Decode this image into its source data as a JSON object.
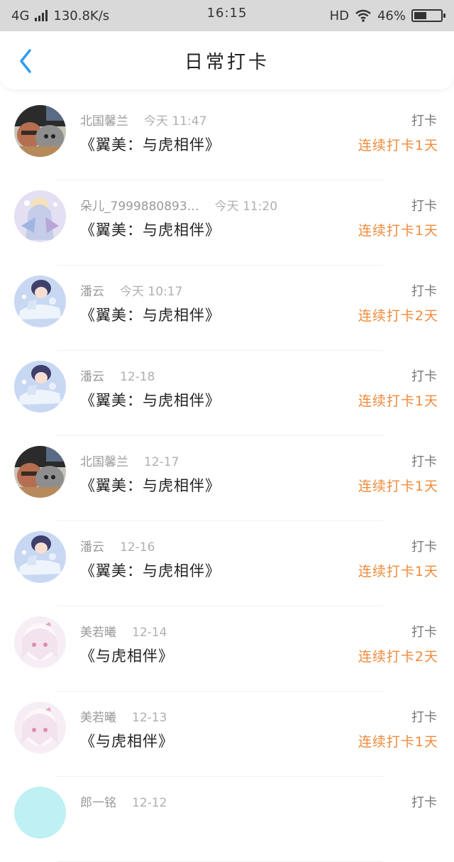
{
  "status_bar": {
    "network": "4G",
    "speed": "130.8K/s",
    "time": "16:15",
    "hd": "HD",
    "battery": "46%",
    "battery_level": 0.46
  },
  "header": {
    "title": "日常打卡",
    "back_icon": "chevron-left-icon"
  },
  "colors": {
    "accent_blue": "#2f9bf0",
    "streak_orange": "#f08a3b"
  },
  "items": [
    {
      "user": "北国馨兰",
      "time": "今天 11:47",
      "work": "《翼美：与虎相伴》",
      "tag": "打卡",
      "streak": "连续打卡1天",
      "avatar": "avatar-photo"
    },
    {
      "user": "朵儿_7999880893…",
      "time": "今天 11:20",
      "work": "《翼美：与虎相伴》",
      "tag": "打卡",
      "streak": "连续打卡1天",
      "avatar": "avatar-anime-lavender"
    },
    {
      "user": "潘云",
      "time": "今天 10:17",
      "work": "《翼美：与虎相伴》",
      "tag": "打卡",
      "streak": "连续打卡2天",
      "avatar": "avatar-anime-blue"
    },
    {
      "user": "潘云",
      "time": "12-18",
      "work": "《翼美：与虎相伴》",
      "tag": "打卡",
      "streak": "连续打卡1天",
      "avatar": "avatar-anime-blue"
    },
    {
      "user": "北国馨兰",
      "time": "12-17",
      "work": "《翼美：与虎相伴》",
      "tag": "打卡",
      "streak": "连续打卡1天",
      "avatar": "avatar-photo"
    },
    {
      "user": "潘云",
      "time": "12-16",
      "work": "《翼美：与虎相伴》",
      "tag": "打卡",
      "streak": "连续打卡1天",
      "avatar": "avatar-anime-blue"
    },
    {
      "user": "美若曦",
      "time": "12-14",
      "work": "《与虎相伴》",
      "tag": "打卡",
      "streak": "连续打卡2天",
      "avatar": "avatar-anime-pink"
    },
    {
      "user": "美若曦",
      "time": "12-13",
      "work": "《与虎相伴》",
      "tag": "打卡",
      "streak": "连续打卡1天",
      "avatar": "avatar-anime-pink"
    },
    {
      "user": "郎一铭",
      "time": "12-12",
      "work": "",
      "tag": "打卡",
      "streak": "",
      "avatar": "avatar-cyan"
    }
  ]
}
